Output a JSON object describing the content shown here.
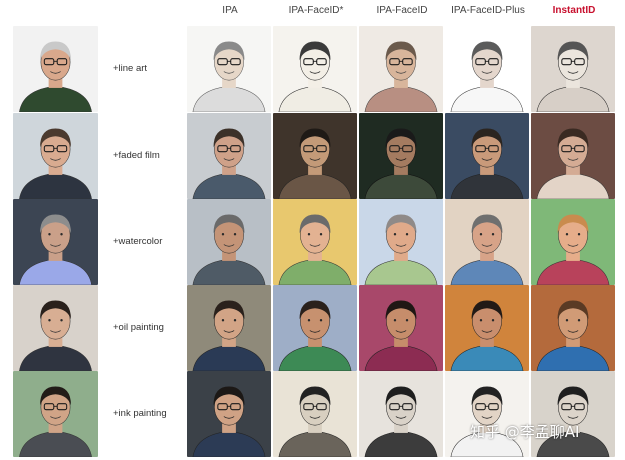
{
  "columns": [
    {
      "label": "IPA",
      "highlight": false
    },
    {
      "label": "IPA-FaceID*",
      "highlight": false
    },
    {
      "label": "IPA-FaceID",
      "highlight": false
    },
    {
      "label": "IPA-FaceID-Plus",
      "highlight": false
    },
    {
      "label": "InstantID",
      "highlight": true
    }
  ],
  "rows": [
    {
      "prompt": "+line art",
      "reference": {
        "bg": "#f2f2f2",
        "skin": "#d9a88c",
        "hair": "#c9c9c9",
        "shirt": "#2f4a2f"
      },
      "results": [
        {
          "bg": "#f6f6f4",
          "skin": "#e6d7c8",
          "hair": "#8a8a8a",
          "shirt": "#dcdcdc",
          "stroke": "#555"
        },
        {
          "bg": "#f5f3ee",
          "skin": "#f3efe6",
          "hair": "#3a3a3a",
          "shirt": "#f0ede4",
          "stroke": "#222"
        },
        {
          "bg": "#efeae4",
          "skin": "#d8b59b",
          "hair": "#6b5a4c",
          "shirt": "#b88f82",
          "stroke": "#444"
        },
        {
          "bg": "#ffffff",
          "skin": "#e4d6cc",
          "hair": "#5b5b5b",
          "shirt": "#f7f7f7",
          "stroke": "#333"
        },
        {
          "bg": "#ddd6cf",
          "skin": "#ebe5dd",
          "hair": "#555555",
          "shirt": "#d7cfc7",
          "stroke": "#222"
        }
      ]
    },
    {
      "prompt": "+faded film",
      "reference": {
        "bg": "#cfd6db",
        "skin": "#d9ab90",
        "hair": "#4b3a2e",
        "shirt": "#2d3440"
      },
      "results": [
        {
          "bg": "#c8ccd0",
          "skin": "#cfa189",
          "hair": "#3c3129",
          "shirt": "#4a5a6b",
          "stroke": "#333"
        },
        {
          "bg": "#3f342b",
          "skin": "#c39a78",
          "hair": "#1f1a16",
          "shirt": "#6a5646",
          "stroke": "#222"
        },
        {
          "bg": "#1f2b22",
          "skin": "#a47b60",
          "hair": "#1a1a1a",
          "shirt": "#3d4a3a",
          "stroke": "#111"
        },
        {
          "bg": "#3a4b62",
          "skin": "#c99a7a",
          "hair": "#2b2520",
          "shirt": "#30343a",
          "stroke": "#222"
        },
        {
          "bg": "#6c4c43",
          "skin": "#d4ab94",
          "hair": "#3a2a22",
          "shirt": "#e3d4c7",
          "stroke": "#333"
        }
      ]
    },
    {
      "prompt": "+watercolor",
      "reference": {
        "bg": "#3c4553",
        "skin": "#caa089",
        "hair": "#8d8d8d",
        "shirt": "#9aa8e8"
      },
      "results": [
        {
          "bg": "#b8bfc6",
          "skin": "#c49477",
          "hair": "#6a6a6a",
          "shirt": "#4f5b66",
          "stroke": "#333"
        },
        {
          "bg": "#e8c86e",
          "skin": "#e3b292",
          "hair": "#6b6b6b",
          "shirt": "#7fae6a",
          "stroke": "#333"
        },
        {
          "bg": "#c9d7e8",
          "skin": "#e0aa8a",
          "hair": "#8f8a88",
          "shirt": "#a8c78f",
          "stroke": "#333"
        },
        {
          "bg": "#e2d3c3",
          "skin": "#d7a388",
          "hair": "#6f6f6f",
          "shirt": "#5e87b8",
          "stroke": "#333"
        },
        {
          "bg": "#7fb878",
          "skin": "#e6ad8a",
          "hair": "#c98b4e",
          "shirt": "#b8425b",
          "stroke": "#333"
        }
      ]
    },
    {
      "prompt": "+oil painting",
      "reference": {
        "bg": "#d8d2cb",
        "skin": "#d8ae93",
        "hair": "#2a211c",
        "shirt": "#2f3440"
      },
      "results": [
        {
          "bg": "#8f8a7a",
          "skin": "#d2a486",
          "hair": "#2a211c",
          "shirt": "#2a3a55",
          "stroke": "#222"
        },
        {
          "bg": "#9eaec7",
          "skin": "#c7916f",
          "hair": "#2a211c",
          "shirt": "#3d8a55",
          "stroke": "#222"
        },
        {
          "bg": "#a8486a",
          "skin": "#c68d6b",
          "hair": "#1f1714",
          "shirt": "#8c2c52",
          "stroke": "#222"
        },
        {
          "bg": "#d0843c",
          "skin": "#c98e6d",
          "hair": "#221a16",
          "shirt": "#3a8ab8",
          "stroke": "#222"
        },
        {
          "bg": "#b46a3c",
          "skin": "#d19b76",
          "hair": "#5a3a24",
          "shirt": "#2f6fb0",
          "stroke": "#222"
        }
      ]
    },
    {
      "prompt": "+ink painting",
      "reference": {
        "bg": "#8fae8c",
        "skin": "#d0a487",
        "hair": "#221c18",
        "shirt": "#4a4d53"
      },
      "results": [
        {
          "bg": "#3b4148",
          "skin": "#cfa285",
          "hair": "#1c1816",
          "shirt": "#2c3b55",
          "stroke": "#222"
        },
        {
          "bg": "#e9e3d6",
          "skin": "#d8cfc0",
          "hair": "#222222",
          "shirt": "#6a645b",
          "stroke": "#222"
        },
        {
          "bg": "#e7e3dd",
          "skin": "#d9d2c8",
          "hair": "#1e1e1e",
          "shirt": "#3c3c3c",
          "stroke": "#222"
        },
        {
          "bg": "#f4f2ee",
          "skin": "#e2d4c6",
          "hair": "#222222",
          "shirt": "#f2f2f2",
          "stroke": "#222"
        },
        {
          "bg": "#d8d3cb",
          "skin": "#dcd4ca",
          "hair": "#1f1f1f",
          "shirt": "#4a4a4a",
          "stroke": "#222"
        }
      ]
    }
  ],
  "watermark": "知乎 @李孟聊AI",
  "colors": {
    "highlight": "#c8102e",
    "header_text": "#444444"
  }
}
